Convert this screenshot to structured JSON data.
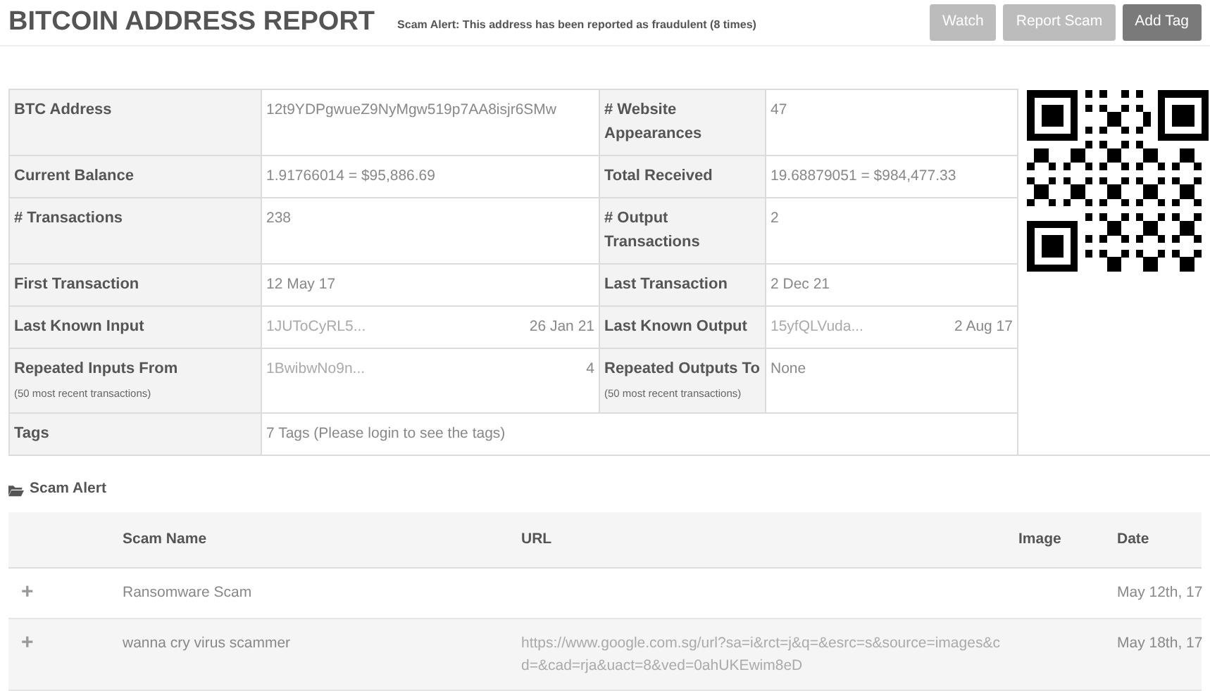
{
  "header": {
    "title": "BITCOIN ADDRESS REPORT",
    "alert": "Scam Alert: This address has been reported as fraudulent (8 times)",
    "buttons": [
      {
        "label": "Watch",
        "kind": "light"
      },
      {
        "label": "Report Scam",
        "kind": "light"
      },
      {
        "label": "Add Tag",
        "kind": "dark"
      }
    ]
  },
  "details": [
    {
      "kind": "pair",
      "left": {
        "label": "BTC Address",
        "value": "12t9YDPgwueZ9NyMgw519p7AA8isjr6SMw"
      },
      "right": {
        "label": "# Website Appearances",
        "value": "47"
      }
    },
    {
      "kind": "pair",
      "left": {
        "label": "Current Balance",
        "value": "1.91766014  =  $95,886.69"
      },
      "right": {
        "label": "Total Received",
        "value": "19.68879051  =  $984,477.33"
      }
    },
    {
      "kind": "pair",
      "left": {
        "label": "# Transactions",
        "value": "238"
      },
      "right": {
        "label": "# Output Transactions",
        "value": "2"
      }
    },
    {
      "kind": "pair",
      "left": {
        "label": "First Transaction",
        "value": "12 May 17"
      },
      "right": {
        "label": "Last Transaction",
        "value": "2 Dec 21"
      }
    },
    {
      "kind": "pair",
      "left": {
        "label": "Last Known Input",
        "value": "1JUToCyRL5...",
        "extra": "26 Jan 21"
      },
      "right": {
        "label": "Last Known Output",
        "value": "15yfQLVuda...",
        "extra": "2 Aug 17"
      }
    },
    {
      "kind": "pair",
      "left": {
        "label": "Repeated Inputs From",
        "note": "(50 most recent transactions)",
        "value": "1BwibwNo9n...",
        "extra": "4"
      },
      "right": {
        "label": "Repeated Outputs To",
        "note": "(50 most recent transactions)",
        "value": "None"
      }
    },
    {
      "kind": "full",
      "left": {
        "label": "Tags",
        "value": "7 Tags (Please login to see the tags)"
      }
    }
  ],
  "scam_section": {
    "title": "Scam Alert",
    "columns": [
      "Scam Name",
      "URL",
      "Image",
      "Date"
    ],
    "rows": [
      {
        "expander": "+",
        "name": "Ransomware Scam",
        "date": "May 12th, 17"
      },
      {
        "expander": "+",
        "name": "wanna cry virus scammer",
        "url": "https://www.google.com.sg/url?sa=i&rct=j&q=&esrc=s&source=images&cd=&cad=rja&uact=8&ved=0ahUKEwim8eD",
        "date": "May 18th, 17"
      }
    ]
  }
}
